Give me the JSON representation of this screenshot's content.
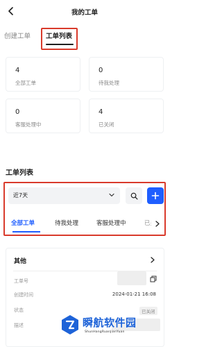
{
  "header": {
    "title": "我的工单"
  },
  "tabs": {
    "create": "创建工单",
    "list": "工单列表"
  },
  "stats": [
    {
      "value": "4",
      "label": "全部工单"
    },
    {
      "value": "0",
      "label": "待我处理"
    },
    {
      "value": "0",
      "label": "客服处理中"
    },
    {
      "value": "4",
      "label": "已关闭"
    }
  ],
  "section": {
    "title": "工单列表"
  },
  "filter": {
    "range": "近7天",
    "tabs": [
      "全部工单",
      "待我处理",
      "客服处理中",
      "已关闭"
    ],
    "active_tab": "全部工单"
  },
  "ticket": {
    "title": "其他",
    "id_label": "工单号",
    "time_label": "创建时间",
    "time_value": "2024-01-21 16:08",
    "status_label": "状态",
    "status_value": "已关闭",
    "desc_label": "描述"
  },
  "watermark": {
    "name": "瞬航软件园",
    "subtitle": "ShunHangRuanJianYuan"
  },
  "colors": {
    "accent": "#1f5eff",
    "highlight": "#d93a2b",
    "text": "#1f1f1f",
    "muted": "#8a8a8a"
  }
}
